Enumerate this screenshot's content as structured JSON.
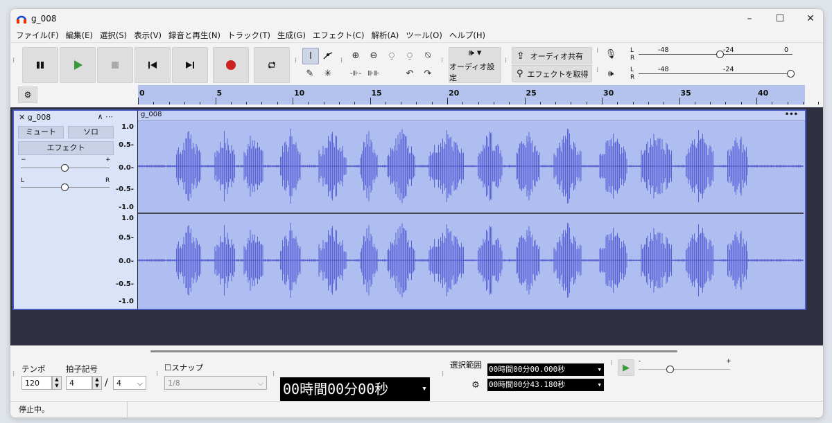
{
  "window": {
    "title": "g_008"
  },
  "menu": [
    "ファイル(F)",
    "編集(E)",
    "選択(S)",
    "表示(V)",
    "録音と再生(N)",
    "トラック(T)",
    "生成(G)",
    "エフェクト(C)",
    "解析(A)",
    "ツール(O)",
    "ヘルプ(H)"
  ],
  "toolbar": {
    "audio_setup": "オーディオ設定",
    "share_audio": "オーディオ共有",
    "get_effects": "エフェクトを取得"
  },
  "meters": {
    "record": {
      "channels": "L\nR",
      "ticks": [
        "-48",
        "-24",
        "0"
      ]
    },
    "play": {
      "channels": "L\nR",
      "ticks": [
        "-48",
        "-24"
      ]
    }
  },
  "ruler": {
    "labels": [
      "0",
      "5",
      "10",
      "15",
      "20",
      "25",
      "30",
      "35",
      "40"
    ]
  },
  "track": {
    "name": "g_008",
    "mute": "ミュート",
    "solo": "ソロ",
    "effects": "エフェクト",
    "gain_minus": "−",
    "gain_plus": "+",
    "pan_left": "L",
    "pan_right": "R",
    "clip_name": "g_008",
    "clip_menu": "•••",
    "menu_glyph": "∧ ⋯",
    "close_glyph": "✕",
    "scale": [
      "1.0",
      "0.5-",
      "0.0-",
      "-0.5-",
      "-1.0"
    ]
  },
  "bottom": {
    "tempo_label": "テンポ",
    "tempo": "120",
    "timesig_label": "拍子記号",
    "timesig_num": "4",
    "timesig_sep": "/",
    "timesig_den": "4",
    "snap_label": "スナップ",
    "snap_value": "1/8",
    "time": "00時間00分00秒",
    "selection_label": "選択範囲",
    "sel_start": "00時間00分00.000秒",
    "sel_end": "00時間00分43.180秒",
    "speed_minus": "-",
    "speed_plus": "+"
  },
  "status": {
    "text": "停止中。"
  }
}
